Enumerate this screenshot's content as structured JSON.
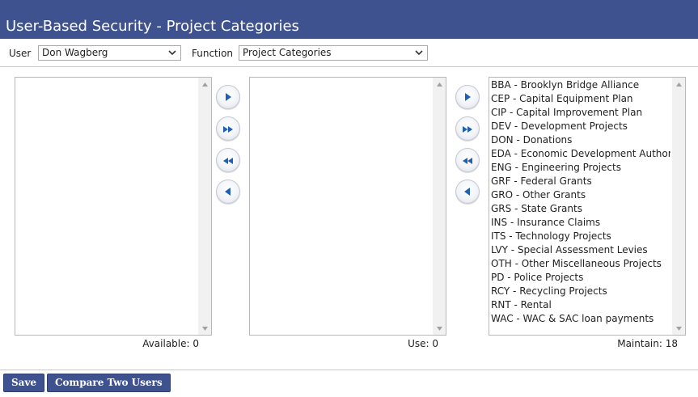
{
  "header": {
    "title": "User-Based Security - Project Categories"
  },
  "filters": {
    "user_label": "User",
    "user_value": "Don Wagberg",
    "function_label": "Function",
    "function_value": "Project Categories"
  },
  "lists": {
    "available": {
      "items": [],
      "count_label": "Available: 0"
    },
    "use": {
      "items": [],
      "count_label": "Use: 0"
    },
    "maintain": {
      "count_label": "Maintain: 18",
      "items": [
        "BBA - Brooklyn Bridge Alliance",
        "CEP - Capital Equipment Plan",
        "CIP - Capital Improvement Plan",
        "DEV - Development Projects",
        "DON - Donations",
        "EDA - Economic Development Authority P",
        "ENG - Engineering Projects",
        "GRF - Federal Grants",
        "GRO - Other Grants",
        "GRS - State Grants",
        "INS - Insurance Claims",
        "ITS - Technology Projects",
        "LVY - Special Assessment Levies",
        "OTH - Other Miscellaneous Projects",
        "PD - Police Projects",
        "RCY - Recycling Projects",
        "RNT - Rental",
        "WAC - WAC & SAC loan payments"
      ]
    }
  },
  "buttons": {
    "save": "Save",
    "compare": "Compare Two Users"
  },
  "icons": {
    "move_right": "move-right-icon",
    "move_all_right": "move-all-right-icon",
    "move_all_left": "move-all-left-icon",
    "move_left": "move-left-icon"
  },
  "colors": {
    "header_bg": "#3f5290",
    "button_bg": "#3f5290",
    "arrow_blue": "#1f5fb4"
  }
}
